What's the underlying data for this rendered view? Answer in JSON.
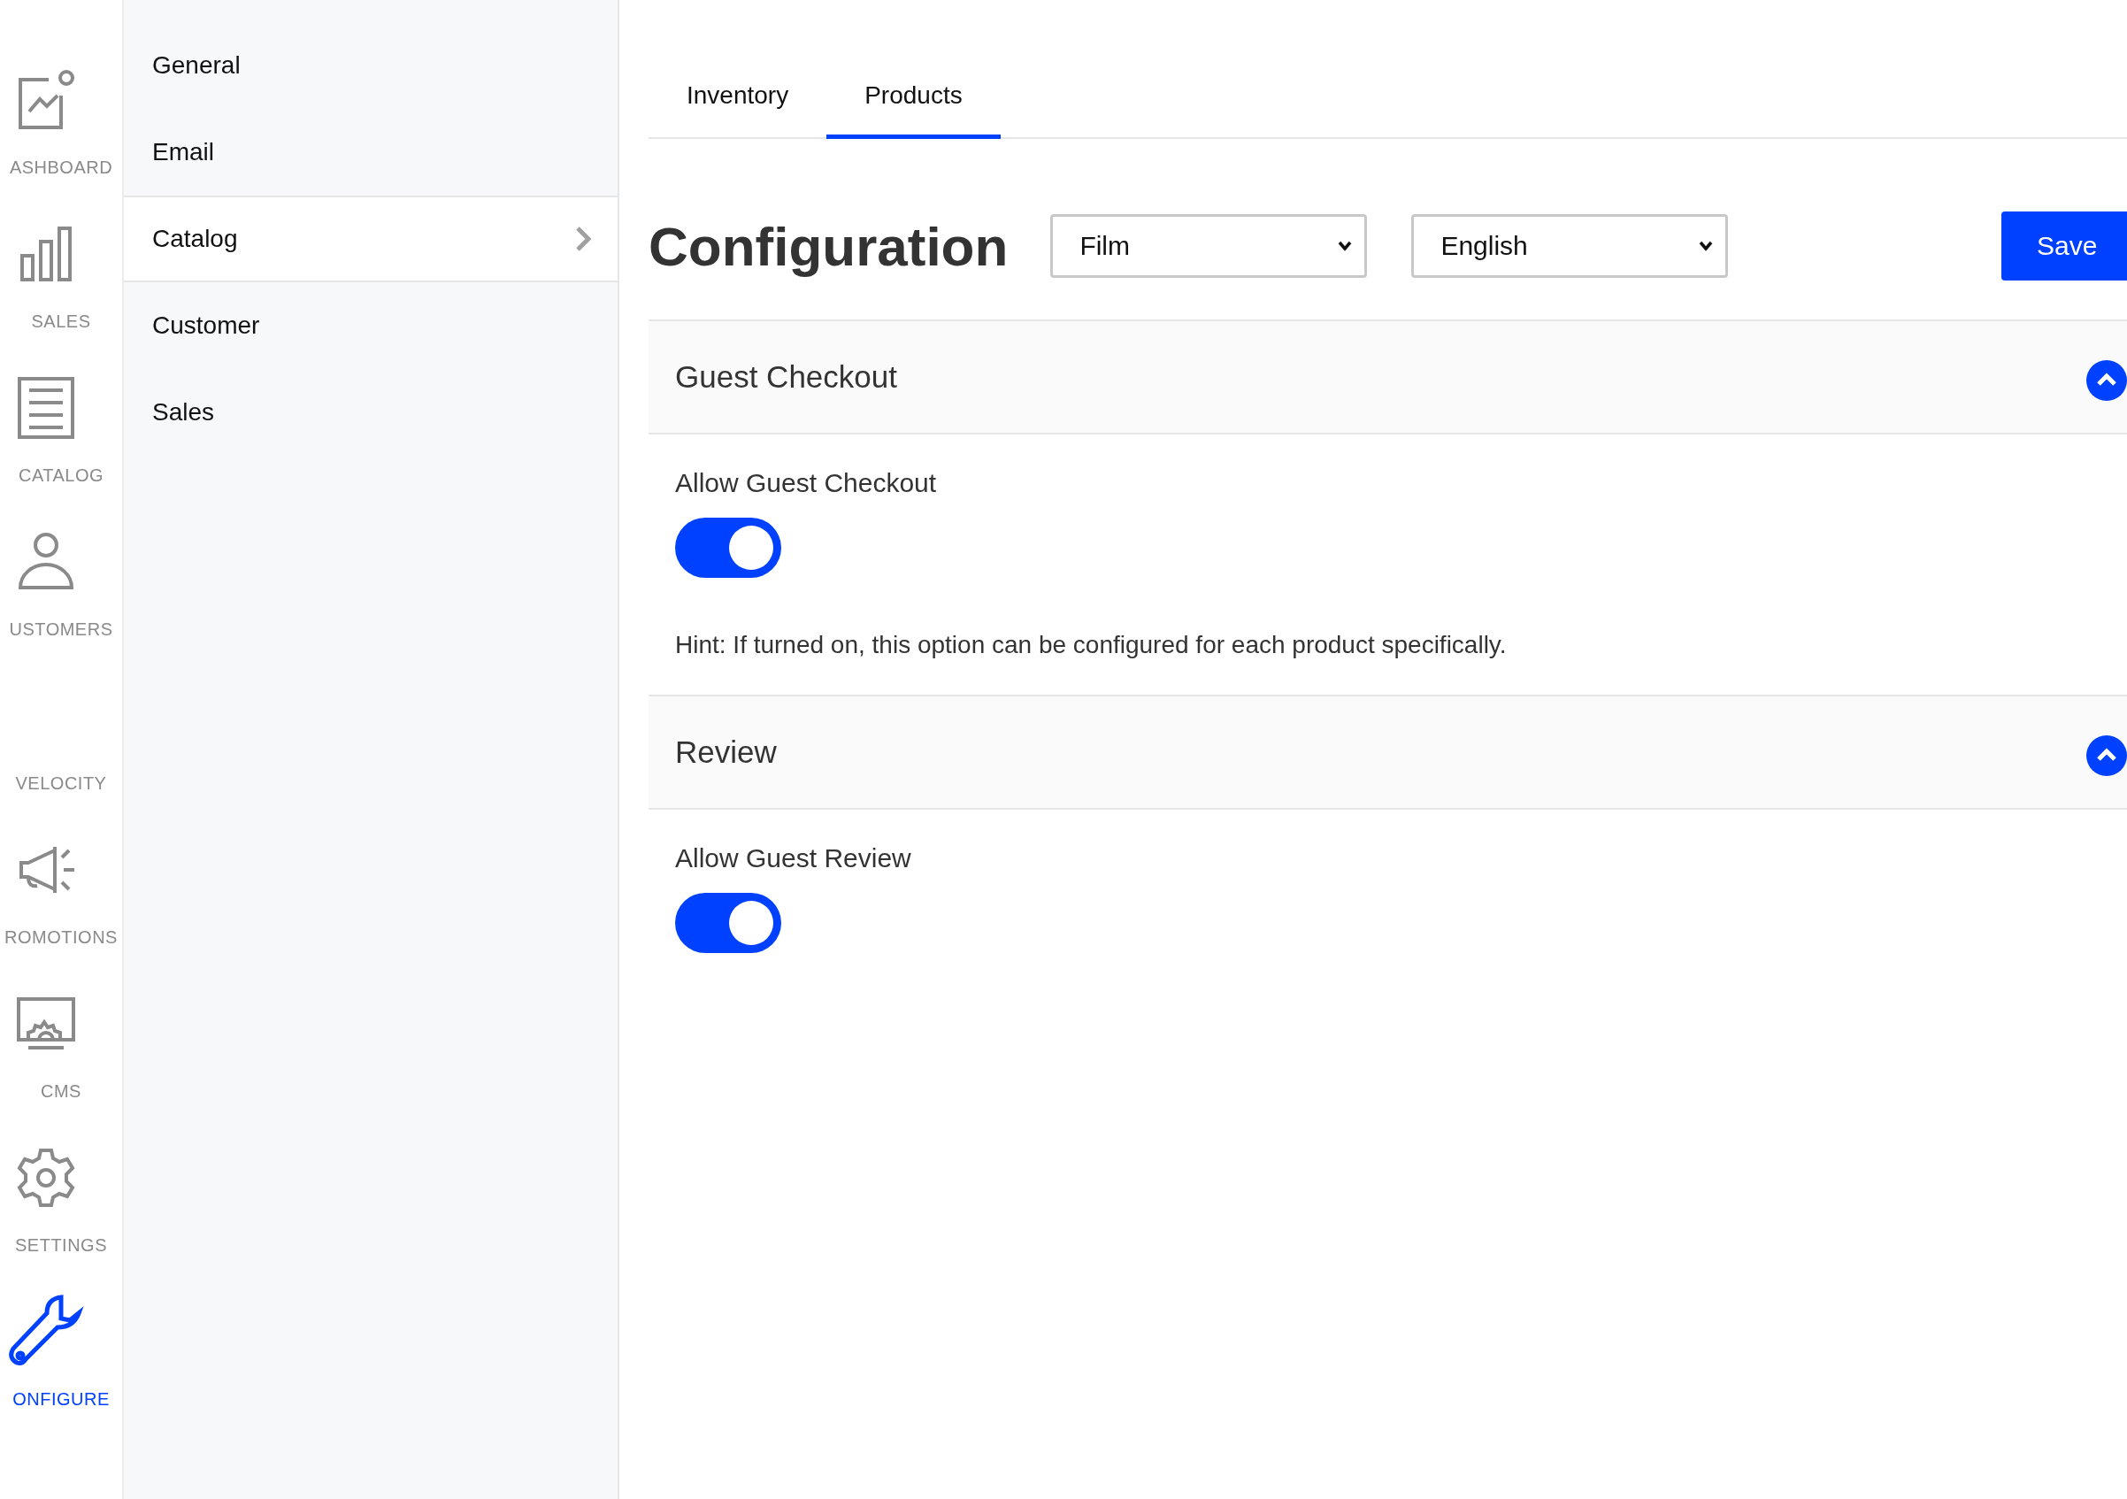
{
  "nav": [
    {
      "label": "ASHBOARD",
      "selected": false
    },
    {
      "label": "SALES",
      "selected": false
    },
    {
      "label": "CATALOG",
      "selected": false
    },
    {
      "label": "USTOMERS",
      "selected": false
    },
    {
      "label": "VELOCITY",
      "selected": false
    },
    {
      "label": "ROMOTIONS",
      "selected": false
    },
    {
      "label": "CMS",
      "selected": false
    },
    {
      "label": "SETTINGS",
      "selected": false
    },
    {
      "label": "ONFIGURE",
      "selected": true
    }
  ],
  "sidebar": {
    "items": [
      {
        "label": "General",
        "selected": false
      },
      {
        "label": "Email",
        "selected": false
      },
      {
        "label": "Catalog",
        "selected": true
      },
      {
        "label": "Customer",
        "selected": false
      },
      {
        "label": "Sales",
        "selected": false
      }
    ]
  },
  "tabs": [
    {
      "label": "Inventory",
      "selected": false
    },
    {
      "label": "Products",
      "selected": true
    }
  ],
  "header": {
    "title": "Configuration",
    "channel": "Film",
    "locale": "English",
    "save": "Save"
  },
  "sections": [
    {
      "title": "Guest Checkout",
      "expanded": true,
      "fields": [
        {
          "label": "Allow Guest Checkout",
          "on": true,
          "hint": "Hint: If turned on, this option can be configured for each product specifically."
        }
      ]
    },
    {
      "title": "Review",
      "expanded": true,
      "fields": [
        {
          "label": "Allow Guest Review",
          "on": true
        }
      ]
    }
  ]
}
